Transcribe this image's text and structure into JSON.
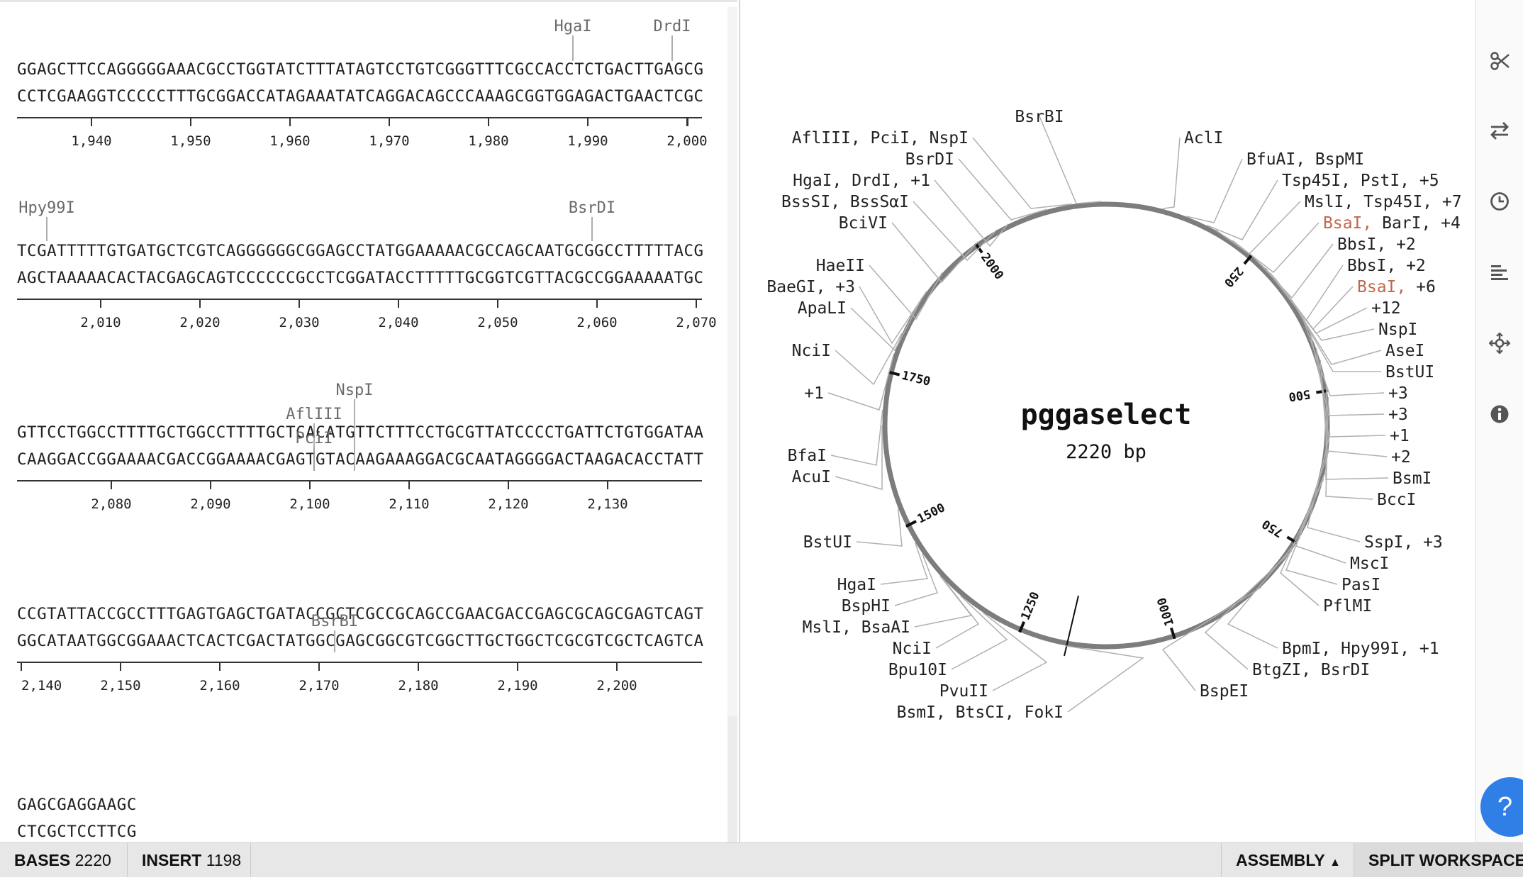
{
  "sequence_view": {
    "blocks": [
      {
        "top": "GGAGCTTCCAGGGGGAAACGCCTGGTATCTTTATAGTCCTGTCGGGTTTCGCCACCTCTGACTTGAGCG",
        "bottom": "CCTCGAAGGTCCCCCTTTGCGGACCATAGAAATATCAGGACAGCCCAAAGCGGTGGAGACTGAACTCGC",
        "ticks": [
          "1,940",
          "1,950",
          "1,960",
          "1,970",
          "1,980",
          "1,990",
          "2,000"
        ],
        "cutsites": [
          {
            "label": "HgaI"
          },
          {
            "label": "DrdI"
          }
        ]
      },
      {
        "top": "TCGATTTTTGTGATGCTCGTCAGGGGGGCGGAGCCTATGGAAAAACGCCAGCAATGCGGCCTTTTTACG",
        "bottom": "AGCTAAAAACACTACGAGCAGTCCCCCCGCCTCGGATACCTTTTTGCGGTCGTTACGCCGGAAAAATGC",
        "ticks": [
          "2,010",
          "2,020",
          "2,030",
          "2,040",
          "2,050",
          "2,060",
          "2,070"
        ],
        "cutsites": [
          {
            "label": "Hpy99I"
          },
          {
            "label": "BsrDI"
          }
        ]
      },
      {
        "top": "GTTCCTGGCCTTTTGCTGGCCTTTTGCTCACATGTTCTTTCCTGCGTTATCCCCTGATTCTGTGGATAA",
        "bottom": "CAAGGACCGGAAAACGACCGGAAAACGAGTGTACAAGAAAGGACGCAATAGGGGACTAAGACACCTATT",
        "ticks": [
          "2,080",
          "2,090",
          "2,100",
          "2,110",
          "2,120",
          "2,130"
        ],
        "cutsites": [
          {
            "label": "NspI"
          },
          {
            "label": "AflIII"
          },
          {
            "label": "PciI"
          }
        ]
      },
      {
        "top": "CCGTATTACCGCCTTTGAGTGAGCTGATACCGCTCGCCGCAGCCGAACGACCGAGCGCAGCGAGTCAGT",
        "bottom": "GGCATAATGGCGGAAACTCACTCGACTATGGCGAGCGGCGTCGGCTTGCTGGCTCGCGTCGCTCAGTCA",
        "ticks": [
          "2,140",
          "2,150",
          "2,160",
          "2,170",
          "2,180",
          "2,190",
          "2,200"
        ],
        "cutsites": [
          {
            "label": "BsrBI"
          }
        ]
      },
      {
        "top": "GAGCGAGGAAGC",
        "bottom": "CTCGCTCCTTCG",
        "ticks": [],
        "cutsites": []
      }
    ]
  },
  "plasmid": {
    "name": "pggaselect",
    "size_label": "2220 bp",
    "length": 2220,
    "ring_ticks": [
      "250",
      "500",
      "750",
      "1000",
      "1250",
      "1500",
      "1750",
      "2000"
    ],
    "labels": [
      {
        "text": "BsrBI"
      },
      {
        "text": "AflIII, PciI, NspI"
      },
      {
        "text": "BsrDI"
      },
      {
        "text": "HgaI, DrdI, +1"
      },
      {
        "text": "BssSI, BssSαI"
      },
      {
        "text": "BciVI"
      },
      {
        "text": "HaeII"
      },
      {
        "text": "BaeGI, +3"
      },
      {
        "text": "ApaLI"
      },
      {
        "text": "NciI"
      },
      {
        "text": "+1"
      },
      {
        "text": "BfaI"
      },
      {
        "text": "AcuI"
      },
      {
        "text": "BstUI"
      },
      {
        "text": "HgaI"
      },
      {
        "text": "BspHI"
      },
      {
        "text": "MslI, BsaAI"
      },
      {
        "text": "NciI"
      },
      {
        "text": "Bpu10I"
      },
      {
        "text": "PvuII"
      },
      {
        "text": "BsmI, BtsCI, FokI"
      },
      {
        "text": "AclI"
      },
      {
        "text": "BfuAI, BspMI"
      },
      {
        "text": "Tsp45I, PstI, +5"
      },
      {
        "text": "MslI, Tsp45I, +7"
      },
      {
        "text": "BsaI, BarI, +4",
        "hl": "BsaI,"
      },
      {
        "text": "BbsI, +2"
      },
      {
        "text": "BbsI, +2"
      },
      {
        "text": "BsaI, +6",
        "hl": "BsaI,"
      },
      {
        "text": "+12"
      },
      {
        "text": "NspI"
      },
      {
        "text": "AseI"
      },
      {
        "text": "BstUI"
      },
      {
        "text": "+3"
      },
      {
        "text": "+3"
      },
      {
        "text": "+1"
      },
      {
        "text": "+2"
      },
      {
        "text": "BsmI"
      },
      {
        "text": "BccI"
      },
      {
        "text": "SspI, +3"
      },
      {
        "text": "MscI"
      },
      {
        "text": "PasI"
      },
      {
        "text": "PflMI"
      },
      {
        "text": "BpmI, Hpy99I, +1"
      },
      {
        "text": "BtgZI, BsrDI"
      },
      {
        "text": "BspEI"
      }
    ]
  },
  "toolbar": {
    "icons": [
      "scissors-icon",
      "swap-arrows-icon",
      "history-clock-icon",
      "align-lines-icon",
      "move-crosshair-icon",
      "info-icon"
    ]
  },
  "status": {
    "bases_label": "BASES",
    "bases_value": "2220",
    "insert_label": "INSERT",
    "insert_value": "1198",
    "assembly_label": "ASSEMBLY",
    "assembly_caret": "▲",
    "split_label": "SPLIT WORKSPACE"
  },
  "help": {
    "label": "?"
  },
  "colors": {
    "ring": "#7d7d7d",
    "highlight": "#c0674a",
    "text": "#222222",
    "leader": "#b0b0b0"
  }
}
